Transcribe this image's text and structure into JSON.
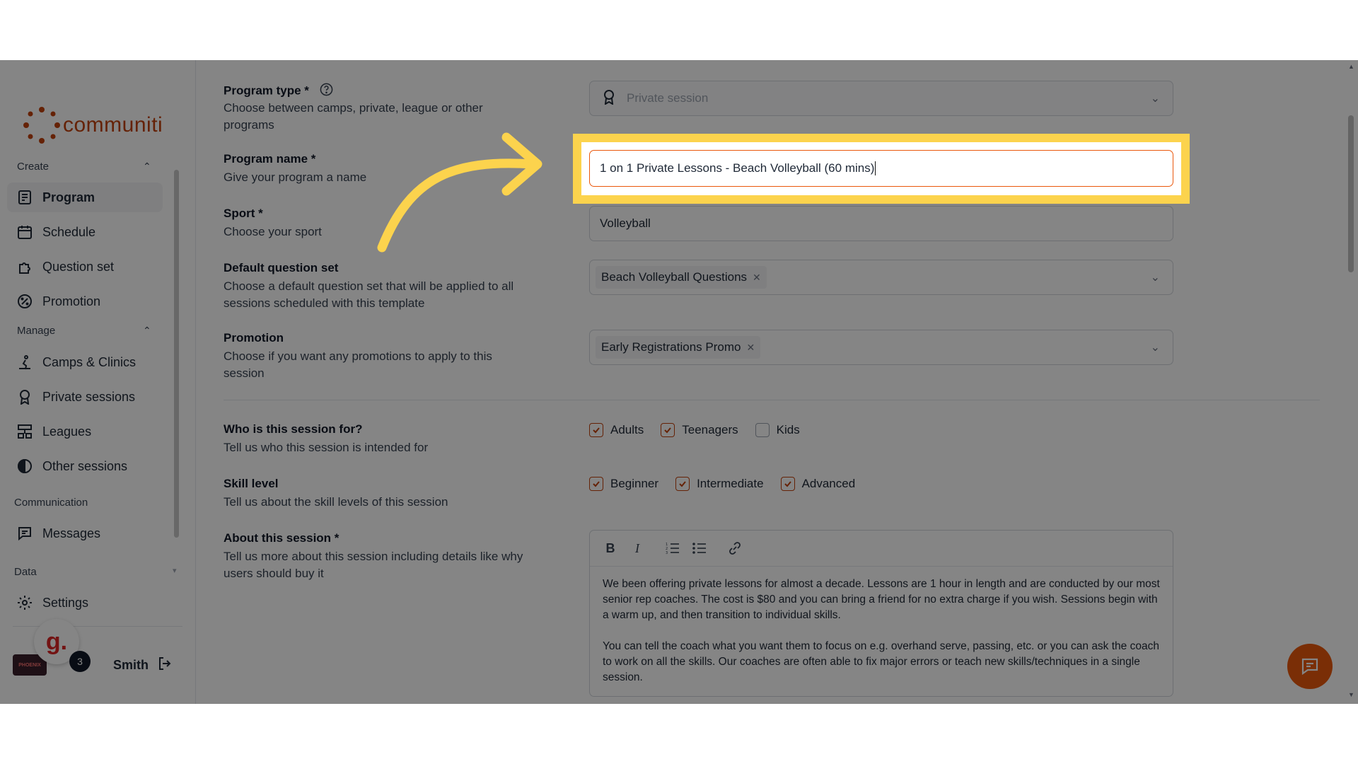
{
  "brand": {
    "name": "communiti"
  },
  "sidebar": {
    "sections": {
      "create": "Create",
      "manage": "Manage",
      "communication": "Communication",
      "data": "Data"
    },
    "items": [
      {
        "label": "Program",
        "icon": "document-icon"
      },
      {
        "label": "Schedule",
        "icon": "calendar-icon"
      },
      {
        "label": "Question set",
        "icon": "puzzle-icon"
      },
      {
        "label": "Promotion",
        "icon": "percent-icon"
      },
      {
        "label": "Camps & Clinics",
        "icon": "person-run-icon"
      },
      {
        "label": "Private sessions",
        "icon": "award-icon"
      },
      {
        "label": "Leagues",
        "icon": "tournament-icon"
      },
      {
        "label": "Other sessions",
        "icon": "half-circle-icon"
      },
      {
        "label": "Messages",
        "icon": "message-icon"
      },
      {
        "label": "Settings",
        "icon": "gear-icon"
      }
    ],
    "user": {
      "name": "Smith",
      "notifications": "3",
      "helper_badge": "g."
    }
  },
  "form": {
    "program_type": {
      "title": "Program type *",
      "desc": "Choose between camps, private, league or other programs",
      "value": "Private session"
    },
    "program_name": {
      "title": "Program name *",
      "desc": "Give your program a name",
      "value": "1 on 1 Private Lessons - Beach Volleyball (60 mins)"
    },
    "sport": {
      "title": "Sport *",
      "desc": "Choose your sport",
      "value": "Volleyball"
    },
    "question_set": {
      "title": "Default question set",
      "desc": "Choose a default question set that will be applied to all sessions scheduled with this template",
      "chip": "Beach Volleyball Questions"
    },
    "promotion": {
      "title": "Promotion",
      "desc": "Choose if you want any promotions to apply to this session",
      "chip": "Early Registrations Promo"
    },
    "audience": {
      "title": "Who is this session for?",
      "desc": "Tell us who this session is intended for",
      "options": [
        {
          "label": "Adults",
          "checked": true
        },
        {
          "label": "Teenagers",
          "checked": true
        },
        {
          "label": "Kids",
          "checked": false
        }
      ]
    },
    "skill": {
      "title": "Skill level",
      "desc": "Tell us about the skill levels of this session",
      "options": [
        {
          "label": "Beginner",
          "checked": true
        },
        {
          "label": "Intermediate",
          "checked": true
        },
        {
          "label": "Advanced",
          "checked": true
        }
      ]
    },
    "about": {
      "title": "About this session *",
      "desc": "Tell us more about this session including details like why users should buy it",
      "paragraph1": "We been offering private lessons for almost a decade. Lessons are 1 hour in length and are conducted by our most senior rep coaches. The cost is $80 and you can bring a friend for no extra charge if you wish. Sessions begin with a warm up, and then transition to individual skills.",
      "paragraph2": "You can tell the coach what you want them to focus on e.g. overhand serve, passing, etc. or you can ask the coach to work on all the skills. Our coaches are often able to fix major errors or teach new skills/techniques in a single session."
    }
  },
  "colors": {
    "accent": "#ea580c",
    "highlight": "#fcd34d",
    "checkbox": "#c2410c"
  }
}
